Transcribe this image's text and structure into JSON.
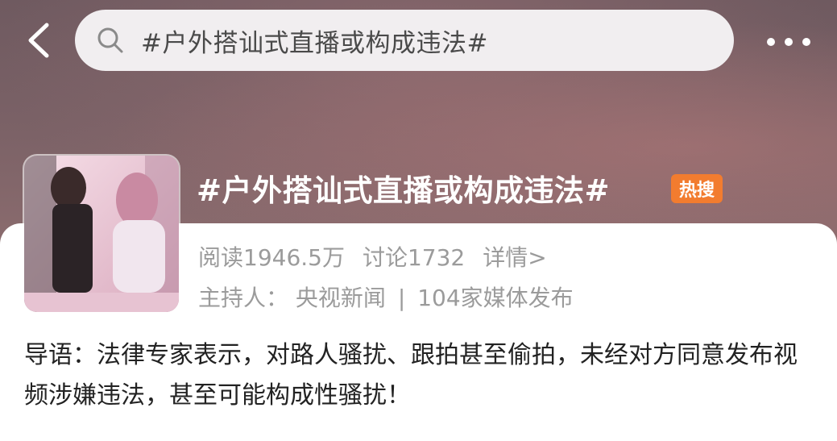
{
  "search": {
    "query": "#户外搭讪式直播或构成违法#"
  },
  "topic": {
    "title": "#户外搭讪式直播或构成违法#",
    "badge": "热搜",
    "reads": "阅读1946.5万",
    "discussions": "讨论1732",
    "detail_link": "详情>",
    "host_label": "主持人：",
    "host_name": "央视新闻",
    "separator": "|",
    "publishers": "104家媒体发布",
    "intro": "导语：法律专家表示，对路人骚扰、跟拍甚至偷拍，未经对方同意发布视频涉嫌违法，甚至可能构成性骚扰！"
  },
  "icons": {
    "back": "chevron-left-icon",
    "search": "search-icon",
    "more": "more-dots-icon"
  },
  "colors": {
    "badge": "#f27c2f",
    "muted_text": "#9b9b9b",
    "hero_bg": "#7a6166"
  }
}
